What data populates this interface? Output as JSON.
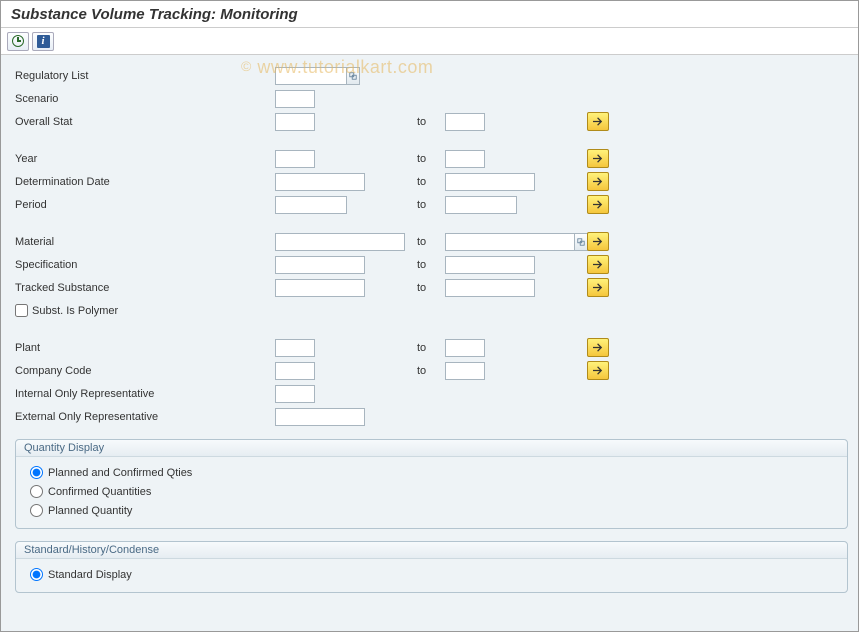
{
  "header": {
    "title": "Substance Volume Tracking: Monitoring"
  },
  "watermark": {
    "text": "www.tutorialkart.com",
    "copyright": "©"
  },
  "labels": {
    "to": "to"
  },
  "fields": {
    "regulatoryList": {
      "label": "Regulatory List",
      "value": ""
    },
    "scenario": {
      "label": "Scenario",
      "value": ""
    },
    "overallStat": {
      "label": "Overall Stat",
      "from": "",
      "to": ""
    },
    "year": {
      "label": "Year",
      "from": "",
      "to": ""
    },
    "determinationDate": {
      "label": "Determination Date",
      "from": "",
      "to": ""
    },
    "period": {
      "label": "Period",
      "from": "",
      "to": ""
    },
    "material": {
      "label": "Material",
      "from": "",
      "to": ""
    },
    "specification": {
      "label": "Specification",
      "from": "",
      "to": ""
    },
    "trackedSubstance": {
      "label": "Tracked Substance",
      "from": "",
      "to": ""
    },
    "substIsPolymer": {
      "label": "Subst. Is Polymer",
      "checked": false
    },
    "plant": {
      "label": "Plant",
      "from": "",
      "to": ""
    },
    "companyCode": {
      "label": "Company Code",
      "from": "",
      "to": ""
    },
    "intOnlyRep": {
      "label": "Internal Only Representative",
      "value": ""
    },
    "extOnlyRep": {
      "label": "External Only Representative",
      "value": ""
    }
  },
  "groups": {
    "qty": {
      "title": "Quantity Display",
      "options": {
        "plannedConfirmed": "Planned and Confirmed Qties",
        "confirmed": "Confirmed Quantities",
        "planned": "Planned Quantity"
      },
      "selected": "plannedConfirmed"
    },
    "mode": {
      "title": "Standard/History/Condense",
      "options": {
        "standard": "Standard Display"
      },
      "selected": "standard"
    }
  }
}
